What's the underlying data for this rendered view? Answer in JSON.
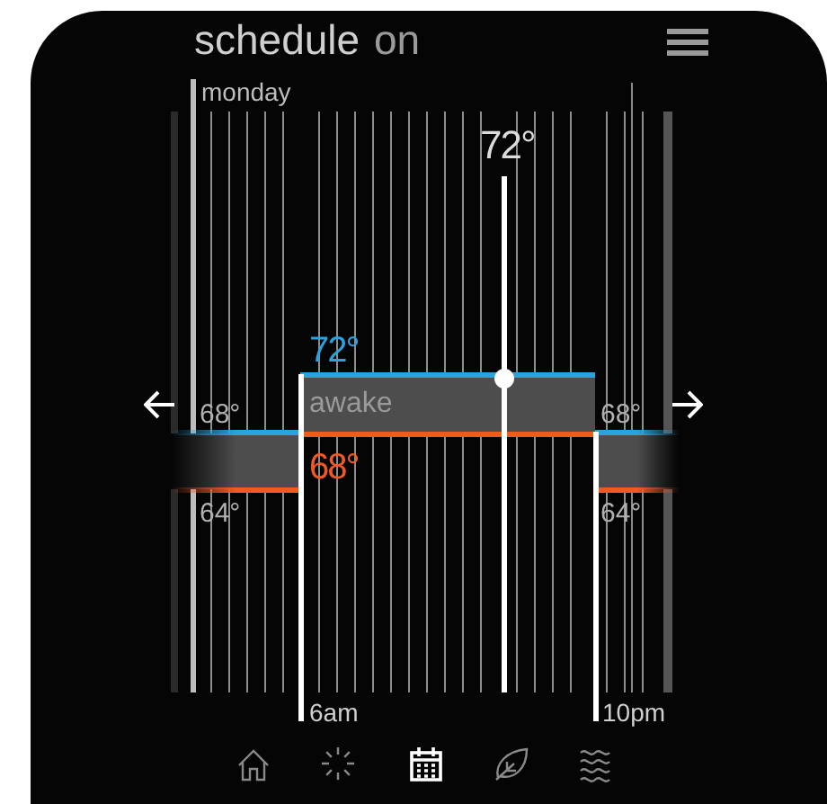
{
  "header": {
    "title": "schedule",
    "status": "on"
  },
  "day": "monday",
  "current_setpoint": "72°",
  "period": {
    "label": "awake",
    "high": "72°",
    "low": "68°",
    "start": "6am",
    "end": "10pm"
  },
  "sides": [
    {
      "high": "68°",
      "low": "64°"
    },
    {
      "high": "68°",
      "low": "64°"
    }
  ],
  "nav": [
    {
      "kind": "home",
      "selected": false
    },
    {
      "kind": "sun",
      "selected": false
    },
    {
      "kind": "calendar",
      "selected": true
    },
    {
      "kind": "leaf",
      "selected": false
    },
    {
      "kind": "waves",
      "selected": false
    }
  ]
}
